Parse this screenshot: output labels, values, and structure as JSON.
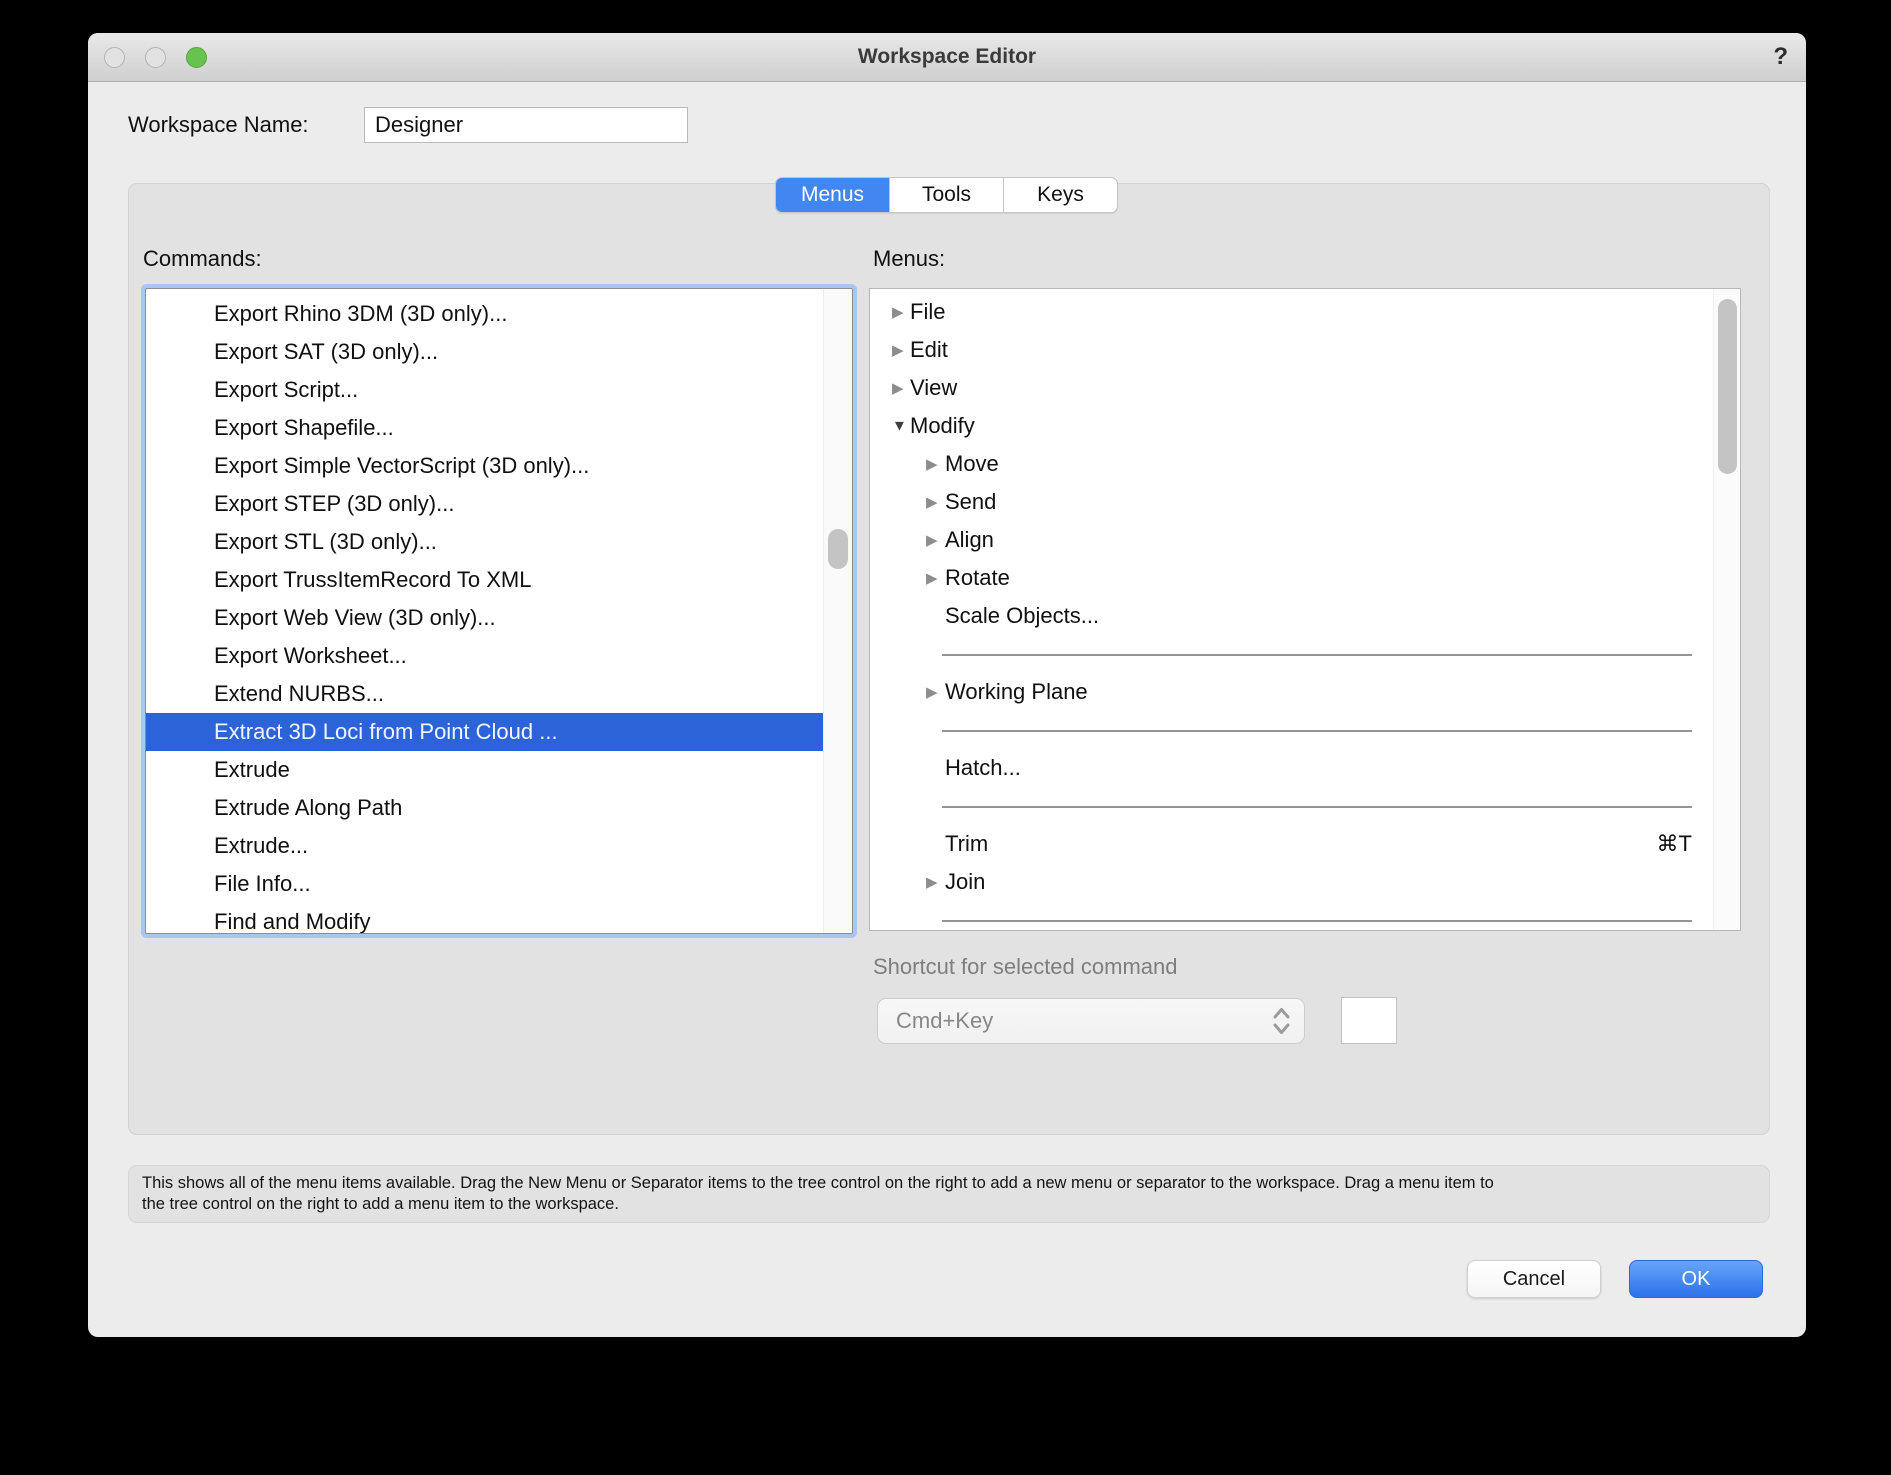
{
  "window": {
    "title": "Workspace Editor",
    "help_label": "?"
  },
  "workspace_name": {
    "label": "Workspace Name:",
    "value": "Designer"
  },
  "tabs": [
    {
      "label": "Menus",
      "selected": true
    },
    {
      "label": "Tools",
      "selected": false
    },
    {
      "label": "Keys",
      "selected": false
    }
  ],
  "commands": {
    "label": "Commands:",
    "selected_index": 11,
    "items": [
      "Export Rhino 3DM (3D only)...",
      "Export SAT (3D only)...",
      "Export Script...",
      "Export Shapefile...",
      "Export Simple VectorScript (3D only)...",
      "Export STEP (3D only)...",
      "Export STL (3D only)...",
      "Export TrussItemRecord To XML",
      "Export Web View (3D only)...",
      "Export Worksheet...",
      "Extend NURBS...",
      "Extract 3D Loci from Point Cloud ...",
      "Extrude",
      "Extrude Along Path",
      "Extrude...",
      "File Info...",
      "Find and Modify"
    ]
  },
  "menus": {
    "label": "Menus:",
    "items": [
      {
        "label": "File",
        "level": 0,
        "disclosure": "collapsed"
      },
      {
        "label": "Edit",
        "level": 0,
        "disclosure": "collapsed"
      },
      {
        "label": "View",
        "level": 0,
        "disclosure": "collapsed"
      },
      {
        "label": "Modify",
        "level": 0,
        "disclosure": "expanded"
      },
      {
        "label": "Move",
        "level": 1,
        "disclosure": "collapsed"
      },
      {
        "label": "Send",
        "level": 1,
        "disclosure": "collapsed"
      },
      {
        "label": "Align",
        "level": 1,
        "disclosure": "collapsed"
      },
      {
        "label": "Rotate",
        "level": 1,
        "disclosure": "collapsed"
      },
      {
        "label": "Scale Objects...",
        "level": 1,
        "disclosure": "none"
      },
      {
        "type": "separator"
      },
      {
        "label": "Working Plane",
        "level": 1,
        "disclosure": "collapsed"
      },
      {
        "type": "separator"
      },
      {
        "label": "Hatch...",
        "level": 1,
        "disclosure": "none"
      },
      {
        "type": "separator"
      },
      {
        "label": "Trim",
        "level": 1,
        "disclosure": "none",
        "shortcut": "⌘T"
      },
      {
        "label": "Join",
        "level": 1,
        "disclosure": "collapsed"
      },
      {
        "type": "separator"
      }
    ]
  },
  "shortcut": {
    "label": "Shortcut for selected command",
    "dropdown_value": "Cmd+Key",
    "key_value": ""
  },
  "description": {
    "line1": "This shows all of the menu items available. Drag the New Menu or Separator items to the tree control on the right to add a new menu or separator to the workspace. Drag a menu item to",
    "line2": "the tree control on the right to add a menu item to the workspace."
  },
  "buttons": {
    "cancel": "Cancel",
    "ok": "OK"
  },
  "colors": {
    "accent_blue": "#4286f2",
    "selection_blue": "#2d63d8",
    "ok_gradient_top": "#67a5f8",
    "ok_gradient_bottom": "#2d71ec",
    "traffic_green": "#68c250",
    "focus_ring": "#a9c6f0"
  }
}
